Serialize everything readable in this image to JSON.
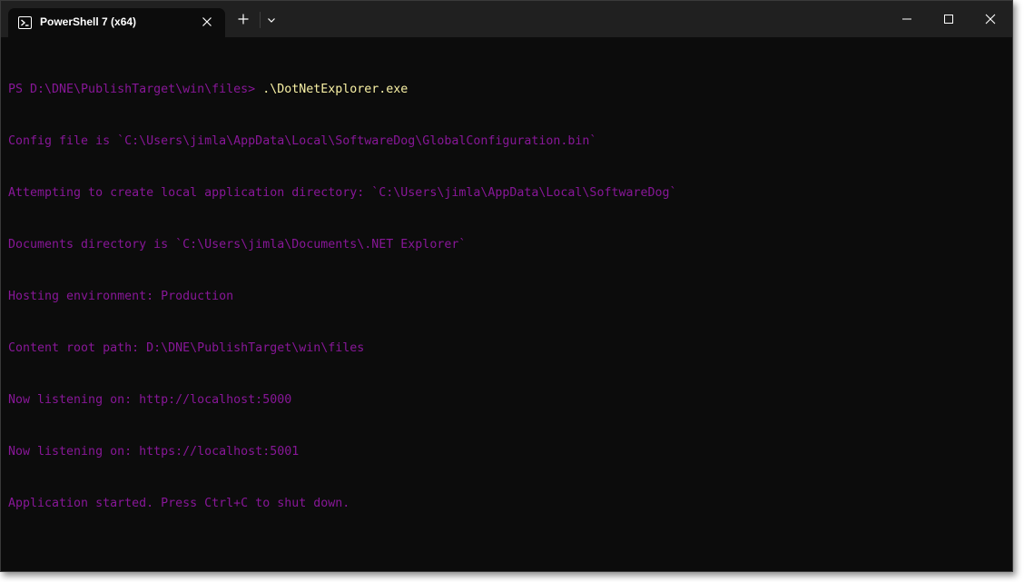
{
  "window": {
    "tab_title": "PowerShell 7 (x64)",
    "icons": {
      "tab": "powershell-icon",
      "close_tab": "close-icon",
      "new_tab": "plus-icon",
      "dropdown": "chevron-down-icon",
      "minimize": "minimize-icon",
      "maximize": "maximize-icon",
      "close_window": "close-icon"
    }
  },
  "terminal": {
    "prompt": "PS D:\\DNE\\PublishTarget\\win\\files> ",
    "command": ".\\DotNetExplorer.exe",
    "output": [
      "Config file is `C:\\Users\\jimla\\AppData\\Local\\SoftwareDog\\GlobalConfiguration.bin`",
      "Attempting to create local application directory: `C:\\Users\\jimla\\AppData\\Local\\SoftwareDog`",
      "Documents directory is `C:\\Users\\jimla\\Documents\\.NET Explorer`",
      "Hosting environment: Production",
      "Content root path: D:\\DNE\\PublishTarget\\win\\files",
      "Now listening on: http://localhost:5000",
      "Now listening on: https://localhost:5001",
      "Application started. Press Ctrl+C to shut down."
    ]
  },
  "colors": {
    "background": "#0c0c0c",
    "titlebar": "#202020",
    "output_text": "#881798",
    "command_text": "#f9f1a5"
  }
}
